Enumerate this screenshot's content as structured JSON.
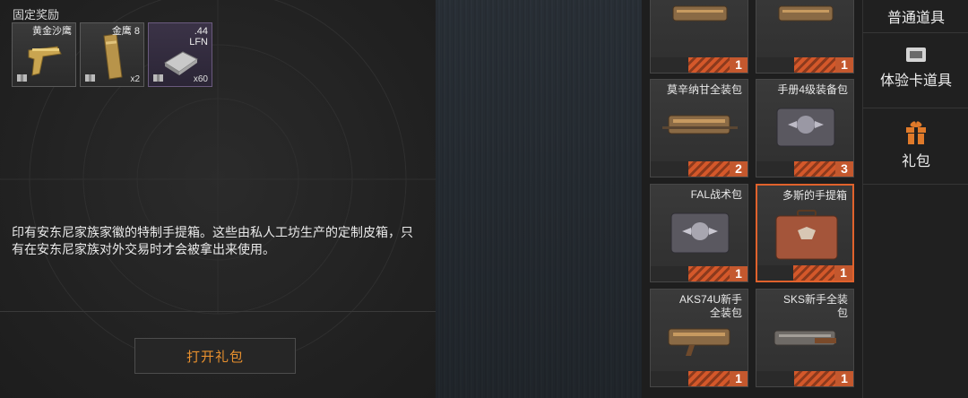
{
  "rewards": {
    "title": "固定奖励",
    "items": [
      {
        "name": "黄金沙鹰",
        "qty": ""
      },
      {
        "name": "金鹰 8",
        "qty": "x2"
      },
      {
        "name": ".44\nLFN",
        "qty": "x60"
      }
    ]
  },
  "description": "印有安东尼家族家徽的特制手提箱。这些由私人工坊生产的定制皮箱，只有在安东尼家族对外交易时才会被拿出来使用。",
  "open_button": "打开礼包",
  "grid": [
    {
      "name": "",
      "count": "1"
    },
    {
      "name": "",
      "count": "1"
    },
    {
      "name": "莫辛纳甘全装包",
      "count": "2"
    },
    {
      "name": "手册4级装备包",
      "count": "3"
    },
    {
      "name": "FAL战术包",
      "count": "1"
    },
    {
      "name": "多斯的手提箱",
      "count": "1"
    },
    {
      "name": "AKS74U新手\n全装包",
      "count": "1"
    },
    {
      "name": "SKS新手全装\n包",
      "count": "1"
    }
  ],
  "categories": [
    {
      "label": "普通道具",
      "icon": "bag-icon"
    },
    {
      "label": "体验卡道具",
      "icon": "card-icon"
    },
    {
      "label": "礼包",
      "icon": "gift-icon"
    }
  ],
  "colors": {
    "accent": "#e0622c",
    "count_bg": "#c4582e",
    "button_text": "#e8902e"
  }
}
